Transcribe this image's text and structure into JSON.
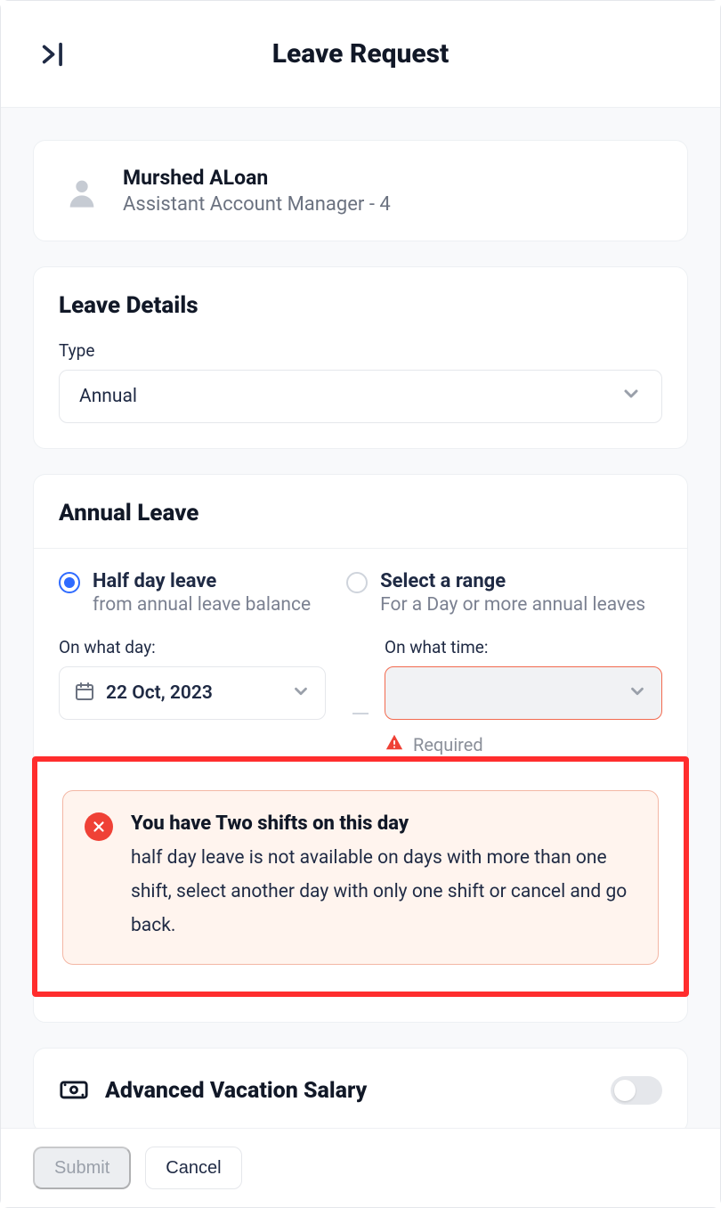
{
  "header": {
    "title": "Leave Request"
  },
  "user": {
    "name": "Murshed ALoan",
    "role": "Assistant Account Manager - 4"
  },
  "leave_details": {
    "title": "Leave Details",
    "type_label": "Type",
    "type_value": "Annual"
  },
  "annual": {
    "title": "Annual Leave",
    "options": {
      "half": {
        "title": "Half day leave",
        "sub": "from annual leave balance",
        "selected": true
      },
      "range": {
        "title": "Select a range",
        "sub": "For a Day or more annual leaves",
        "selected": false
      }
    },
    "day_label": "On what day:",
    "time_label": "On what time:",
    "day_value": "22 Oct, 2023",
    "required_text": "Required",
    "alert": {
      "title": "You have Two shifts on this day",
      "body": "half day leave is not available on days with more than one shift, select another day with only one shift or cancel and go back."
    }
  },
  "avs": {
    "title": "Advanced Vacation Salary",
    "enabled": false
  },
  "footer": {
    "submit": "Submit",
    "cancel": "Cancel"
  },
  "colors": {
    "accent": "#2f6bff",
    "error": "#ef4136",
    "alert_border": "#f3b7a5",
    "alert_bg": "#fff4ee"
  }
}
